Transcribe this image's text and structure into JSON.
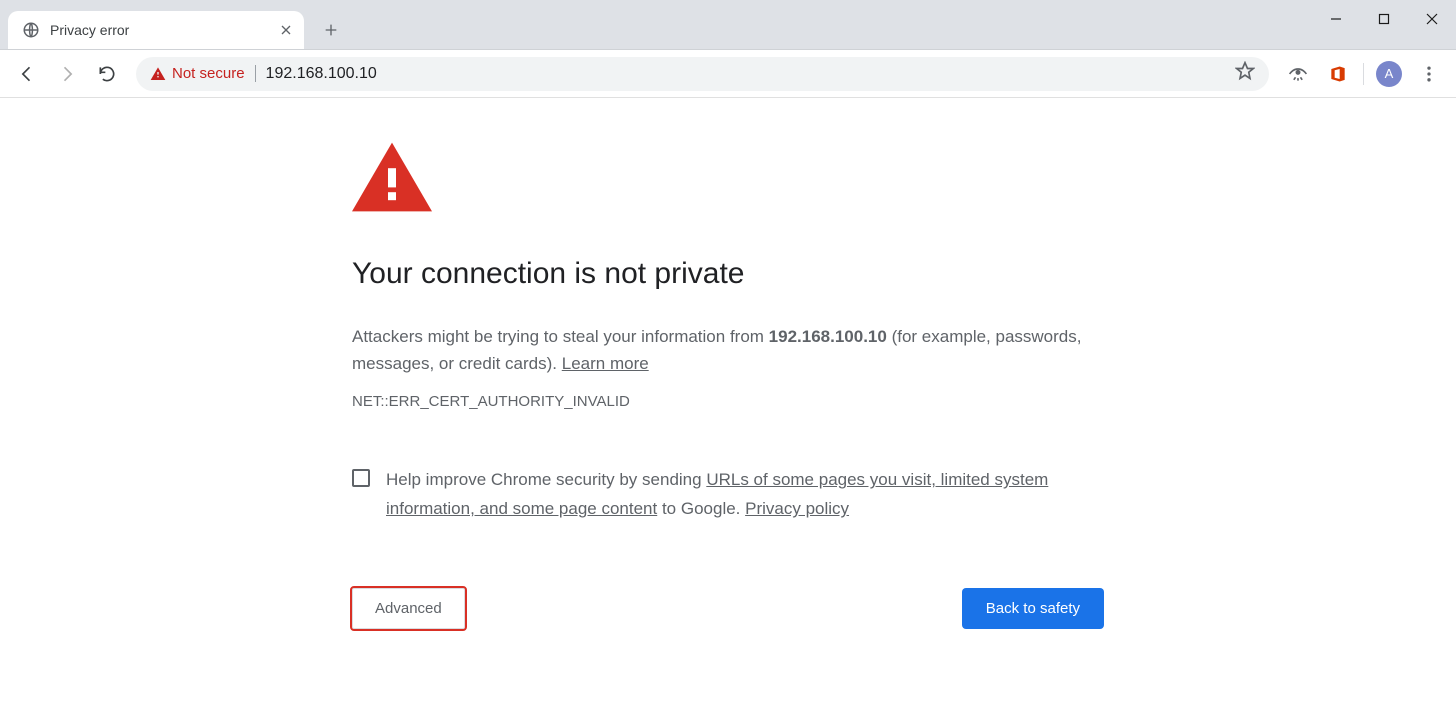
{
  "window": {
    "tab_title": "Privacy error",
    "profile_letter": "A"
  },
  "omnibox": {
    "security_label": "Not secure",
    "url": "192.168.100.10"
  },
  "interstitial": {
    "heading": "Your connection is not private",
    "body_prefix": "Attackers might be trying to steal your information from ",
    "host": "192.168.100.10",
    "body_suffix": " (for example, passwords, messages, or credit cards). ",
    "learn_more": "Learn more",
    "error_code": "NET::ERR_CERT_AUTHORITY_INVALID",
    "opt_in_prefix": "Help improve Chrome security by sending ",
    "opt_in_link1": "URLs of some pages you visit, limited system information, and some page content",
    "opt_in_middle": " to Google. ",
    "opt_in_link2": "Privacy policy",
    "advanced_label": "Advanced",
    "back_label": "Back to safety"
  }
}
